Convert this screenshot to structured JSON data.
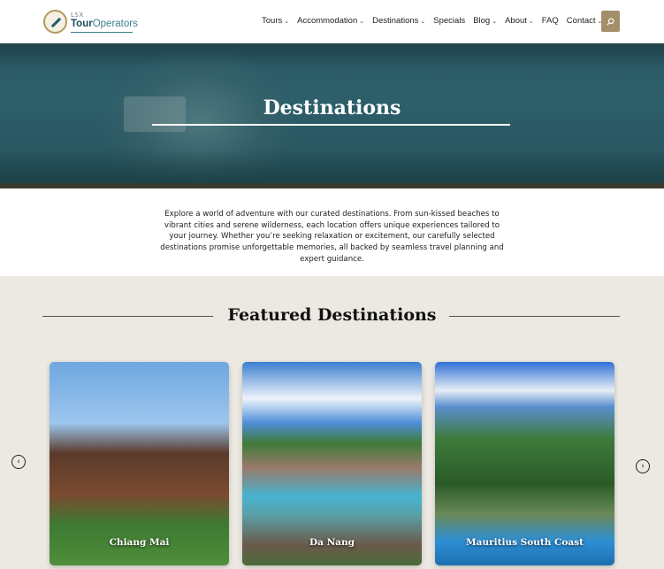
{
  "header": {
    "logo_small": "LSX",
    "logo_main_bold": "Tour",
    "logo_main_light": "Operators",
    "nav": [
      {
        "label": "Tours",
        "has_caret": true
      },
      {
        "label": "Accommodation",
        "has_caret": true
      },
      {
        "label": "Destinations",
        "has_caret": true
      },
      {
        "label": "Specials",
        "has_caret": false
      },
      {
        "label": "Blog",
        "has_caret": true
      },
      {
        "label": "About",
        "has_caret": true
      },
      {
        "label": "FAQ",
        "has_caret": false
      },
      {
        "label": "Contact",
        "has_caret": true
      }
    ],
    "search_icon": "search-icon",
    "accent_color": "#a48f6b"
  },
  "hero": {
    "title": "Destinations"
  },
  "intro": {
    "text": "Explore a world of adventure with our curated destinations. From sun-kissed beaches to vibrant cities and serene wilderness, each location offers unique experiences tailored to your journey. Whether you’re seeking relaxation or excitement, our carefully selected destinations promise unforgettable memories, all backed by seamless travel planning and expert guidance."
  },
  "featured": {
    "title": "Featured Destinations",
    "cards": [
      {
        "label": "Chiang Mai"
      },
      {
        "label": "Da Nang"
      },
      {
        "label": "Mauritius South Coast"
      }
    ],
    "prev_icon": "chevron-left-icon",
    "next_icon": "chevron-right-icon"
  }
}
